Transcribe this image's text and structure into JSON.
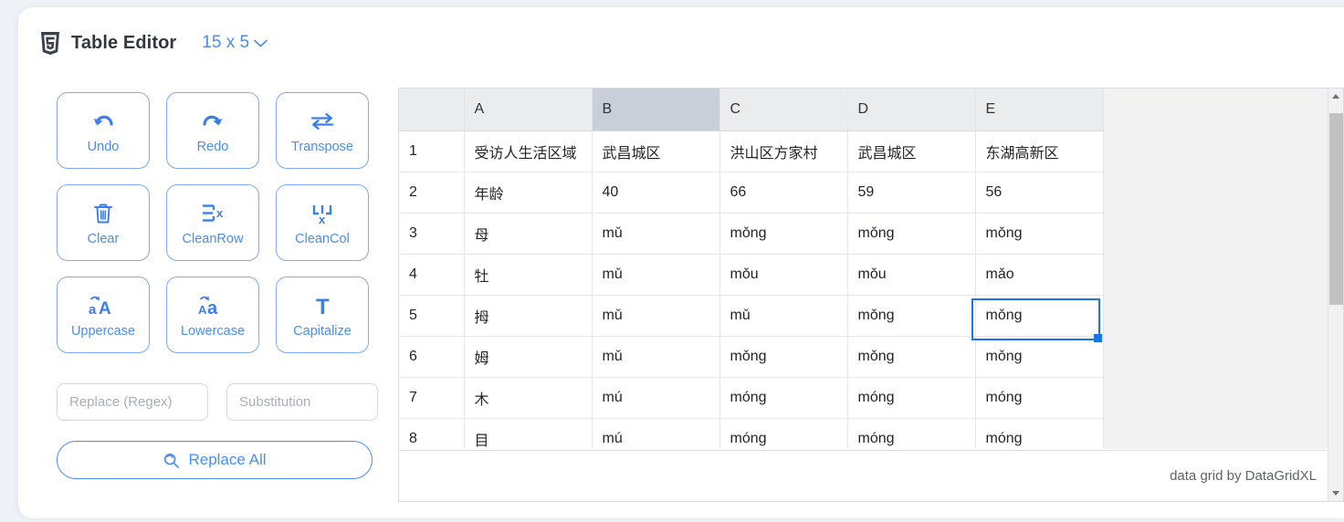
{
  "header": {
    "logo_icon": "html5-shield-icon",
    "title": "Table Editor",
    "size_label": "15 x 5",
    "dropdown_icon": "chevron-down-icon"
  },
  "toolbar": {
    "buttons": [
      {
        "label": "Undo",
        "icon": "undo-arrow-icon"
      },
      {
        "label": "Redo",
        "icon": "redo-arrow-icon"
      },
      {
        "label": "Transpose",
        "icon": "transpose-arrows-icon"
      },
      {
        "label": "Clear",
        "icon": "trash-icon"
      },
      {
        "label": "CleanRow",
        "icon": "clean-row-icon"
      },
      {
        "label": "CleanCol",
        "icon": "clean-col-icon"
      },
      {
        "label": "Uppercase",
        "icon": "uppercase-aA-icon"
      },
      {
        "label": "Lowercase",
        "icon": "lowercase-Aa-icon"
      },
      {
        "label": "Capitalize",
        "icon": "capitalize-T-icon"
      }
    ]
  },
  "replace": {
    "regex_placeholder": "Replace (Regex)",
    "regex_value": "",
    "substitution_placeholder": "Substitution",
    "substitution_value": "",
    "replace_all_label": "Replace All",
    "replace_all_icon": "search-replace-icon"
  },
  "grid": {
    "columns": [
      "A",
      "B",
      "C",
      "D",
      "E"
    ],
    "selected_column": "B",
    "selected_row": "3",
    "selected_cell": "B3",
    "selected_cell_value": "mǔ",
    "rows": [
      {
        "num": "1",
        "cells": [
          "受访人生活区域",
          "武昌城区",
          "洪山区方家村",
          "武昌城区",
          "东湖高新区"
        ]
      },
      {
        "num": "2",
        "cells": [
          "年龄",
          "40",
          "66",
          "59",
          "56"
        ]
      },
      {
        "num": "3",
        "cells": [
          "母",
          "mǔ",
          "mǒng",
          "mǒng",
          "mǒng"
        ]
      },
      {
        "num": "4",
        "cells": [
          "牡",
          "mǔ",
          "mǒu",
          "mǒu",
          "mǎo"
        ]
      },
      {
        "num": "5",
        "cells": [
          "拇",
          "mǔ",
          "mǔ",
          "mǒng",
          "mǒng"
        ]
      },
      {
        "num": "6",
        "cells": [
          "姆",
          "mǔ",
          "mǒng",
          "mǒng",
          "mǒng"
        ]
      },
      {
        "num": "7",
        "cells": [
          "木",
          "mú",
          "móng",
          "móng",
          "móng"
        ]
      },
      {
        "num": "8",
        "cells": [
          "目",
          "mú",
          "móng",
          "móng",
          "móng"
        ]
      }
    ],
    "footer_credit": "data grid by DataGridXL",
    "scrollbar": {
      "up_icon": "scroll-up-arrow-icon",
      "down_icon": "scroll-down-arrow-icon"
    }
  },
  "colors": {
    "accent": "#4a8ef0",
    "selection": "#1a73e8",
    "header_gray": "#eaecee",
    "header_selected_gray": "#c8cfd8",
    "page_bg": "#eef1f5"
  }
}
